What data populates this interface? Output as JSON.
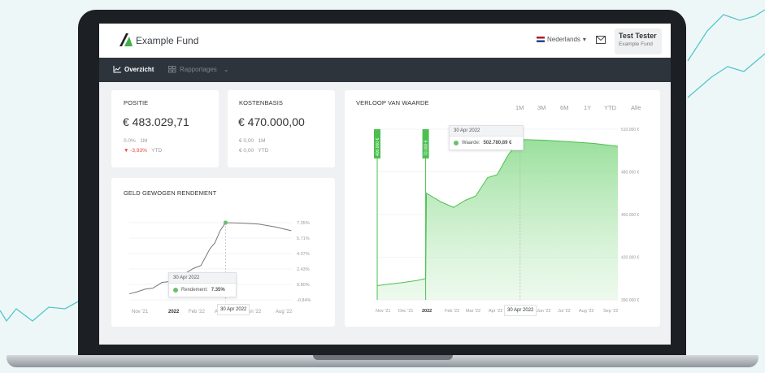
{
  "app": {
    "logo_text": "Example Fund",
    "language": "Nederlands",
    "user_name": "Test Tester",
    "user_fund": "Example Fund"
  },
  "nav": {
    "overview": "Overzicht",
    "reports": "Rapportages"
  },
  "positie": {
    "title": "POSITIE",
    "value": "€ 483.029,71",
    "row1_value": "0.0%",
    "row1_period": "1M",
    "row2_value": "-3,93%",
    "row2_period": "YTD"
  },
  "kostenbasis": {
    "title": "KOSTENBASIS",
    "value": "€ 470.000,00",
    "row1_value": "€ 0,00",
    "row1_period": "1M",
    "row2_value": "€ 0,00",
    "row2_period": "YTD"
  },
  "rendement": {
    "title": "GELD GEWOGEN RENDEMENT",
    "tooltip_date": "30 Apr 2022",
    "tooltip_label": "Rendement:",
    "tooltip_value": "7.35%",
    "x_badge": "30 Apr 2022"
  },
  "verloop": {
    "title": "VERLOOP VAN WAARDE",
    "ranges": [
      "1M",
      "3M",
      "6M",
      "1Y",
      "YTD",
      "Alle"
    ],
    "tooltip_date": "30 Apr 2022",
    "tooltip_label": "Waarde:",
    "tooltip_value": "502.780,89 €",
    "x_badge": "30 Apr 2022"
  },
  "chart_data": [
    {
      "type": "line",
      "title": "GELD GEWOGEN RENDEMENT",
      "x_ticks": [
        "Nov '21",
        "2022",
        "Feb '22",
        "Apr '22",
        "Jun '22",
        "Aug '22"
      ],
      "y_ticks": [
        "7.35%",
        "5.71%",
        "4.07%",
        "2.43%",
        "0.80%",
        "-0.84%"
      ],
      "ylim": [
        -0.84,
        7.35
      ],
      "x": [
        "2021-11-01",
        "2021-11-15",
        "2021-12-01",
        "2021-12-15",
        "2022-01-01",
        "2022-01-15",
        "2022-02-01",
        "2022-02-15",
        "2022-03-01",
        "2022-03-15",
        "2022-04-01",
        "2022-04-10",
        "2022-04-20",
        "2022-04-30",
        "2022-06-01",
        "2022-07-01",
        "2022-08-01",
        "2022-08-31"
      ],
      "series": [
        {
          "values": [
            -0.2,
            0.0,
            0.3,
            0.4,
            1.0,
            1.1,
            1.7,
            2.0,
            2.5,
            2.8,
            4.6,
            5.2,
            6.5,
            7.35,
            7.3,
            7.2,
            6.9,
            6.5
          ]
        }
      ],
      "highlight": {
        "x": "2022-04-30",
        "value": 7.35
      },
      "grid": true
    },
    {
      "type": "area",
      "title": "VERLOOP VAN WAARDE",
      "x_ticks": [
        "Nov '21",
        "Dec '21",
        "2022",
        "Feb '22",
        "Mar '22",
        "Apr '22",
        "May '22",
        "Jun '22",
        "Jul '22",
        "Aug '22",
        "Sep '22"
      ],
      "y_ticks": [
        "510.000 €",
        "480.000 €",
        "450.000 €",
        "420.000 €",
        "390.000 €"
      ],
      "ylim": [
        390000,
        510000
      ],
      "x": [
        "2021-11-01",
        "2021-11-15",
        "2021-12-01",
        "2021-12-20",
        "2022-01-01",
        "2022-01-02",
        "2022-01-20",
        "2022-02-05",
        "2022-02-20",
        "2022-03-05",
        "2022-03-20",
        "2022-04-01",
        "2022-04-15",
        "2022-04-30",
        "2022-06-01",
        "2022-07-01",
        "2022-08-01",
        "2022-08-31"
      ],
      "series": [
        {
          "name": "Waarde",
          "values": [
            400000,
            401000,
            402000,
            403500,
            405000,
            465000,
            459000,
            455000,
            460000,
            463000,
            476000,
            478000,
            492000,
            502780.89,
            502200,
            501200,
            500000,
            498000
          ]
        }
      ],
      "markers": [
        {
          "x": "2021-11-01",
          "label": "400.000 €"
        },
        {
          "x": "2022-01-01",
          "label": "70.000 €"
        }
      ],
      "highlight": {
        "x": "2022-04-30",
        "value": 502780.89
      },
      "grid": true
    }
  ]
}
